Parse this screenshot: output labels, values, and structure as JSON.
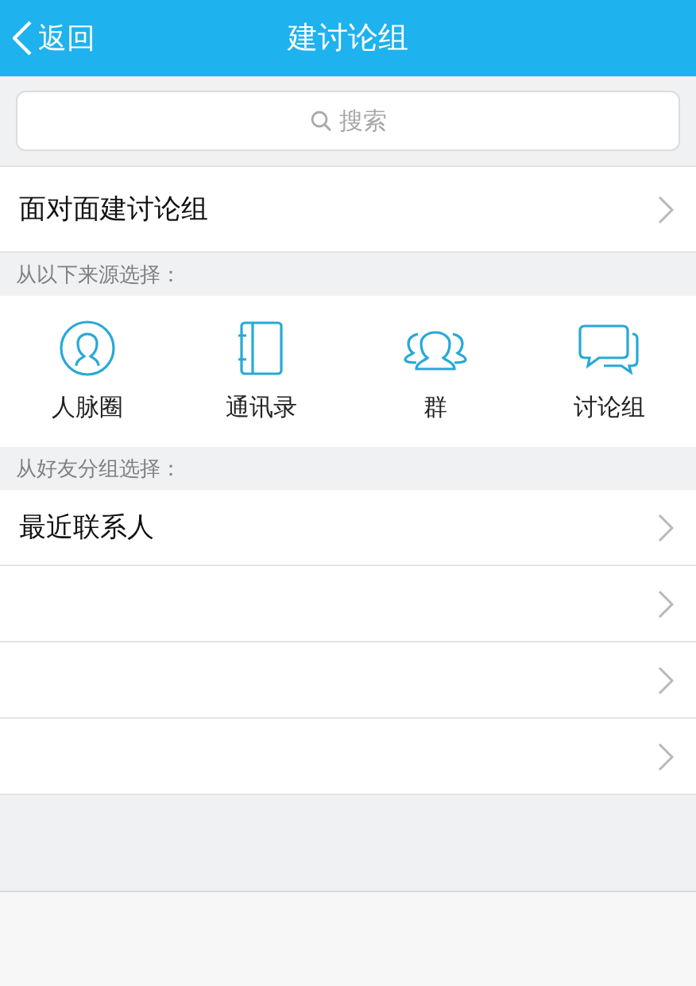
{
  "header": {
    "back": "返回",
    "title": "建讨论组"
  },
  "search": {
    "placeholder": "搜索"
  },
  "face_to_face": {
    "label": "面对面建讨论组"
  },
  "sources": {
    "heading": "从以下来源选择：",
    "items": [
      {
        "kind": "contacts-circle",
        "label": "人脉圈"
      },
      {
        "kind": "address-book",
        "label": "通讯录"
      },
      {
        "kind": "group",
        "label": "群"
      },
      {
        "kind": "discussion",
        "label": "讨论组"
      }
    ]
  },
  "friend_groups": {
    "heading": "从好友分组选择：",
    "rows": [
      {
        "label": "最近联系人"
      },
      {},
      {},
      {}
    ]
  }
}
